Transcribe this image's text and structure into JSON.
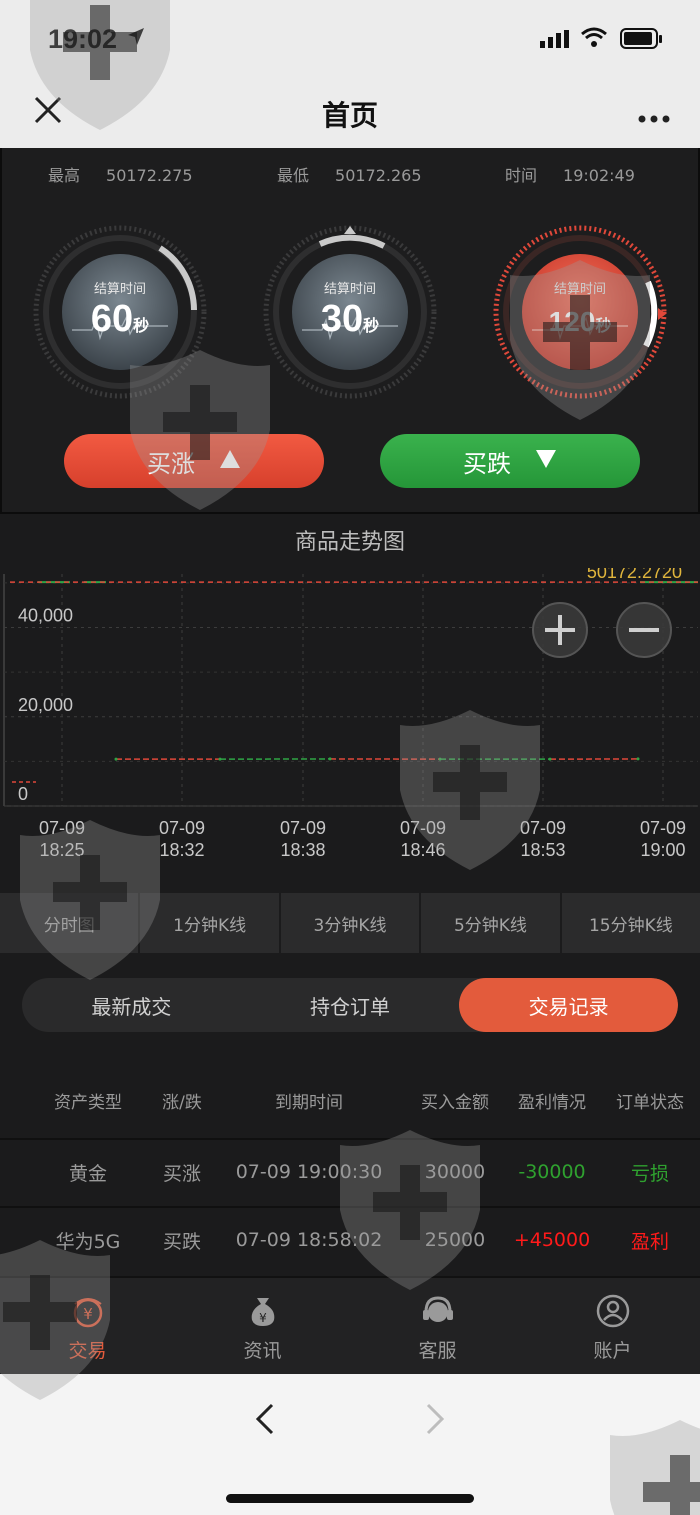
{
  "status_bar": {
    "time": "19:02"
  },
  "title_bar": {
    "title": "首页"
  },
  "stats": {
    "high": {
      "label": "最高",
      "value": "50172.275"
    },
    "low": {
      "label": "最低",
      "value": "50172.265"
    },
    "time": {
      "label": "时间",
      "value": "19:02:49"
    }
  },
  "dials": [
    {
      "label": "结算时间",
      "number": "60",
      "unit": "秒",
      "selected": false
    },
    {
      "label": "结算时间",
      "number": "30",
      "unit": "秒",
      "selected": false
    },
    {
      "label": "结算时间",
      "number": "120",
      "unit": "秒",
      "selected": true
    }
  ],
  "buttons": {
    "buy_up": "买涨",
    "buy_down": "买跌"
  },
  "chart": {
    "title": "商品走势图",
    "current_price_label": "50172.2720",
    "y_ticks": [
      "0",
      "20,000",
      "40,000"
    ],
    "x_ticks": [
      {
        "date": "07-09",
        "time": "18:25"
      },
      {
        "date": "07-09",
        "time": "18:32"
      },
      {
        "date": "07-09",
        "time": "18:38"
      },
      {
        "date": "07-09",
        "time": "18:46"
      },
      {
        "date": "07-09",
        "time": "18:53"
      },
      {
        "date": "07-09",
        "time": "19:00"
      }
    ]
  },
  "chart_data": {
    "type": "line",
    "title": "商品走势图",
    "x": [
      "18:25",
      "18:32",
      "18:38",
      "18:46",
      "18:53",
      "19:00"
    ],
    "ylim": [
      0,
      52000
    ],
    "y_ticks": [
      0,
      20000,
      40000
    ],
    "series": [
      {
        "values": [
          10500,
          10500,
          10550,
          10500,
          10500,
          10550
        ]
      }
    ],
    "reference_line": 50172.272,
    "grid": true
  },
  "kline_tabs": [
    "分时图",
    "1分钟K线",
    "3分钟K线",
    "5分钟K线",
    "15分钟K线"
  ],
  "order_tabs": [
    "最新成交",
    "持仓订单",
    "交易记录"
  ],
  "order_tabs_active": 2,
  "table": {
    "headers": [
      "资产类型",
      "涨/跌",
      "到期时间",
      "买入金额",
      "盈利情况",
      "订单状态"
    ],
    "rows": [
      {
        "asset": "黄金",
        "direction": "买涨",
        "expiry": "07-09 19:00:30",
        "amount": "30000",
        "profit": "-30000",
        "status": "亏损"
      },
      {
        "asset": "华为5G",
        "direction": "买跌",
        "expiry": "07-09 18:58:02",
        "amount": "25000",
        "profit": "+45000",
        "status": "盈利"
      }
    ]
  },
  "bottom_nav": [
    {
      "label": "交易",
      "icon": "yen-coin-icon",
      "active": true
    },
    {
      "label": "资讯",
      "icon": "money-bag-icon",
      "active": false
    },
    {
      "label": "客服",
      "icon": "headset-icon",
      "active": false
    },
    {
      "label": "账户",
      "icon": "user-icon",
      "active": false
    }
  ],
  "colors": {
    "buy_up": "#e0483a",
    "buy_down": "#2fa545",
    "accent": "#e35b3c",
    "loss": "#2fa12f",
    "gain": "#ff1a1a",
    "price_label": "#e0b53c"
  }
}
